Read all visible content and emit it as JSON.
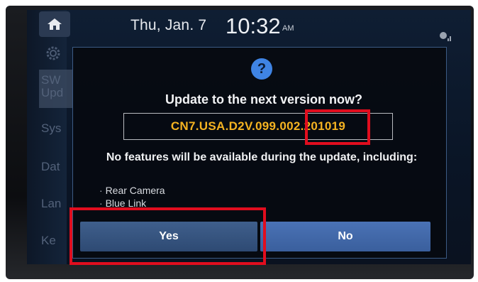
{
  "status_bar": {
    "date": "Thu, Jan. 7",
    "time": "10:32",
    "ampm": "AM"
  },
  "sidebar": {
    "items": [
      {
        "label": "SW\nUpd"
      },
      {
        "label": "Sys"
      },
      {
        "label": "Dat"
      },
      {
        "label": "Lan"
      },
      {
        "label": "Ke"
      }
    ]
  },
  "dialog": {
    "icon": "question-icon",
    "icon_glyph": "?",
    "prompt": "Update to the next version now?",
    "version": "CN7.USA.D2V.099.002.201019",
    "warning": "No features will be available during the update, including:",
    "features": [
      "Rear Camera",
      "Blue Link"
    ],
    "yes_label": "Yes",
    "no_label": "No"
  },
  "colors": {
    "version_text": "#f5b321",
    "annotation": "#e10d1e",
    "yes_button": "#2e4a73",
    "no_button": "#3a5f9d",
    "info_icon": "#3f84e4"
  }
}
